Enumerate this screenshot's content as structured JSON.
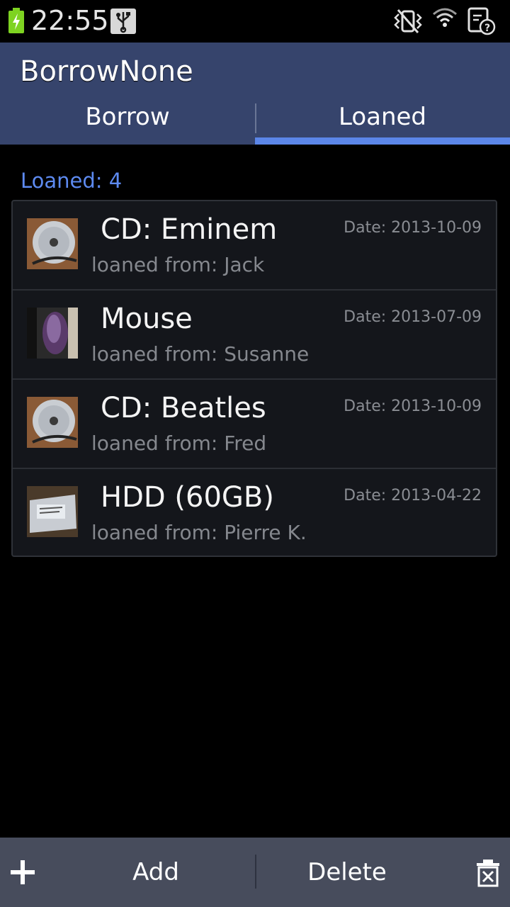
{
  "status_bar": {
    "time": "22:55",
    "icons": [
      "battery-charging-icon",
      "usb-icon",
      "vibrate-icon",
      "wifi-icon",
      "sync-error-icon"
    ]
  },
  "app": {
    "title": "BorrowNone"
  },
  "tabs": [
    {
      "label": "Borrow",
      "selected": false
    },
    {
      "label": "Loaned",
      "selected": true
    }
  ],
  "list": {
    "header": "Loaned: 4",
    "items": [
      {
        "title": "CD: Eminem",
        "subtitle": "loaned from: Jack",
        "date": "Date: 2013-10-09",
        "thumbnail": "cd-image"
      },
      {
        "title": "Mouse",
        "subtitle": "loaned from: Susanne",
        "date": "Date: 2013-07-09",
        "thumbnail": "mouse-image"
      },
      {
        "title": "CD: Beatles",
        "subtitle": "loaned from: Fred",
        "date": "Date: 2013-10-09",
        "thumbnail": "cd-image"
      },
      {
        "title": "HDD (60GB)",
        "subtitle": "loaned from: Pierre K.",
        "date": "Date: 2013-04-22",
        "thumbnail": "hdd-image"
      }
    ]
  },
  "bottom_bar": {
    "add_label": "Add",
    "delete_label": "Delete",
    "icons": [
      "plus-icon",
      "trash-icon"
    ]
  },
  "colors": {
    "action_bar": "#36446c",
    "tab_indicator": "#5b86e8",
    "section_header": "#5d8af0",
    "list_background": "#14161b",
    "bottom_bar": "#474c5c"
  }
}
